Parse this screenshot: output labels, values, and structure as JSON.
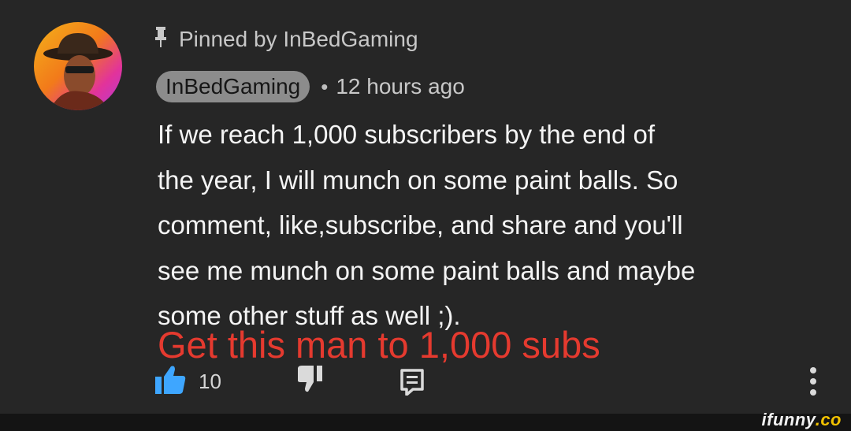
{
  "pinned": {
    "label": "Pinned by InBedGaming",
    "icon": "pin-icon"
  },
  "comment": {
    "author": "InBedGaming",
    "separator": "•",
    "timestamp": "12 hours ago",
    "text_lines": [
      "If we reach 1,000 subscribers by the end of",
      "the year, I will munch on some paint balls. So",
      "comment, like,subscribe, and share and you'll",
      "see me munch on some paint balls and maybe",
      "some other stuff as well ;)."
    ]
  },
  "overlay_caption": "Get this man to 1,000 subs",
  "actions": {
    "like_count": "10",
    "icons": [
      "thumbs-up-icon",
      "thumbs-down-icon",
      "reply-icon",
      "more-vert-icon"
    ],
    "like_color": "#3ea6ff"
  },
  "watermark": {
    "main": "ifunny",
    "suffix": ".co"
  },
  "colors": {
    "background": "#262626",
    "caption": "#e53a2f",
    "chip": "#8c8c8c"
  }
}
